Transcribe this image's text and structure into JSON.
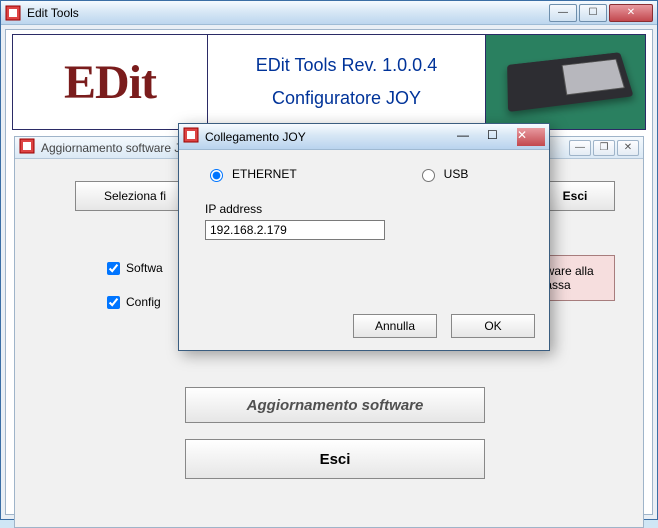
{
  "main": {
    "title": "Edit Tools",
    "header": {
      "logo_text": "EDit",
      "line1": "EDit Tools   Rev. 1.0.0.4",
      "line2": "Configuratore JOY"
    }
  },
  "child": {
    "title": "Aggiornamento software JOY",
    "select_file_label": "Seleziona fi",
    "esci_label": "Esci",
    "chk_software_label": "Softwa",
    "chk_config_label": "Config",
    "invia_label": "a software alla cassa",
    "agg_label": "Aggiornamento software",
    "esci2_label": "Esci"
  },
  "modal": {
    "title": "Collegamento JOY",
    "radio_ethernet": "ETHERNET",
    "radio_usb": "USB",
    "ip_label": "IP address",
    "ip_value": "192.168.2.179",
    "cancel_label": "Annulla",
    "ok_label": "OK"
  },
  "icons": {
    "min": "—",
    "max": "☐",
    "restore": "❐",
    "close": "✕"
  }
}
